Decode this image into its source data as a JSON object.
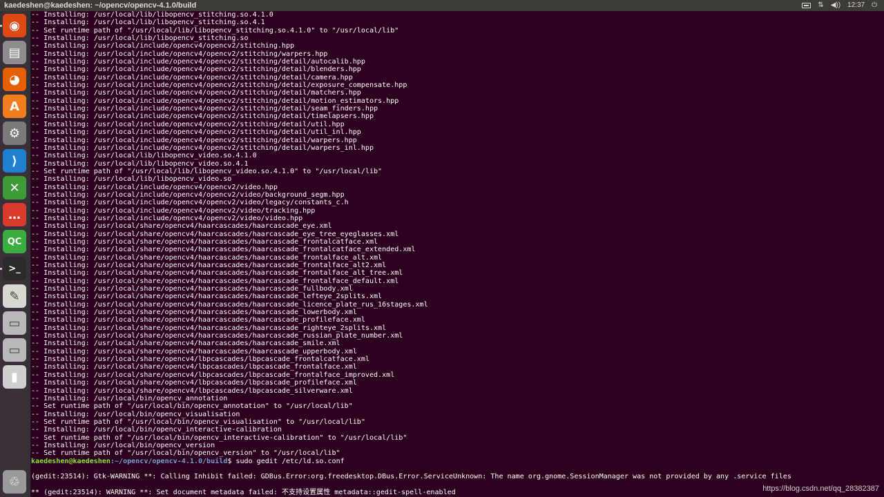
{
  "top_panel": {
    "title": "kaedeshen@kaedeshen: ~/opencv/opencv-4.1.0/build",
    "clock": "12:37",
    "tray_icons": [
      "keyboard-icon",
      "network-icon",
      "volume-icon",
      "power-icon"
    ]
  },
  "launcher": {
    "items": [
      {
        "name": "ubuntu-dash-icon",
        "glyph": "◉",
        "color": "#dd4814"
      },
      {
        "name": "files-icon",
        "glyph": "▤",
        "color": "#8d8d8d"
      },
      {
        "name": "firefox-icon",
        "glyph": "◕",
        "color": "#e66000"
      },
      {
        "name": "software-center-icon",
        "glyph": "A",
        "color": "#f07d1e"
      },
      {
        "name": "system-settings-icon",
        "glyph": "⚙",
        "color": "#7a7a7a"
      },
      {
        "name": "vscode-icon",
        "glyph": "⟩",
        "color": "#1f7fd1"
      },
      {
        "name": "system-tools-icon",
        "glyph": "✕",
        "color": "#3e9b3a"
      },
      {
        "name": "messaging-icon",
        "glyph": "…",
        "color": "#d93a2b"
      },
      {
        "name": "qtcreator-icon",
        "glyph": "QC",
        "color": "#3bac40"
      },
      {
        "name": "terminal-icon",
        "glyph": ">_",
        "color": "#2b2b2b"
      },
      {
        "name": "text-editor-icon",
        "glyph": "✎",
        "color": "#d8d8d0"
      },
      {
        "name": "drive-icon",
        "glyph": "▭",
        "color": "#b9b9b9"
      },
      {
        "name": "drive-2-icon",
        "glyph": "▭",
        "color": "#b9b9b9"
      },
      {
        "name": "usb-drive-icon",
        "glyph": "▮",
        "color": "#cfcfcf"
      },
      {
        "name": "trash-icon",
        "glyph": "♲",
        "color": "#9a9a9a"
      }
    ]
  },
  "terminal": {
    "lines": [
      "-- Installing: /usr/local/lib/libopencv_stitching.so.4.1.0",
      "-- Installing: /usr/local/lib/libopencv_stitching.so.4.1",
      "-- Set runtime path of \"/usr/local/lib/libopencv_stitching.so.4.1.0\" to \"/usr/local/lib\"",
      "-- Installing: /usr/local/lib/libopencv_stitching.so",
      "-- Installing: /usr/local/include/opencv4/opencv2/stitching.hpp",
      "-- Installing: /usr/local/include/opencv4/opencv2/stitching/warpers.hpp",
      "-- Installing: /usr/local/include/opencv4/opencv2/stitching/detail/autocalib.hpp",
      "-- Installing: /usr/local/include/opencv4/opencv2/stitching/detail/blenders.hpp",
      "-- Installing: /usr/local/include/opencv4/opencv2/stitching/detail/camera.hpp",
      "-- Installing: /usr/local/include/opencv4/opencv2/stitching/detail/exposure_compensate.hpp",
      "-- Installing: /usr/local/include/opencv4/opencv2/stitching/detail/matchers.hpp",
      "-- Installing: /usr/local/include/opencv4/opencv2/stitching/detail/motion_estimators.hpp",
      "-- Installing: /usr/local/include/opencv4/opencv2/stitching/detail/seam_finders.hpp",
      "-- Installing: /usr/local/include/opencv4/opencv2/stitching/detail/timelapsers.hpp",
      "-- Installing: /usr/local/include/opencv4/opencv2/stitching/detail/util.hpp",
      "-- Installing: /usr/local/include/opencv4/opencv2/stitching/detail/util_inl.hpp",
      "-- Installing: /usr/local/include/opencv4/opencv2/stitching/detail/warpers.hpp",
      "-- Installing: /usr/local/include/opencv4/opencv2/stitching/detail/warpers_inl.hpp",
      "-- Installing: /usr/local/lib/libopencv_video.so.4.1.0",
      "-- Installing: /usr/local/lib/libopencv_video.so.4.1",
      "-- Set runtime path of \"/usr/local/lib/libopencv_video.so.4.1.0\" to \"/usr/local/lib\"",
      "-- Installing: /usr/local/lib/libopencv_video.so",
      "-- Installing: /usr/local/include/opencv4/opencv2/video.hpp",
      "-- Installing: /usr/local/include/opencv4/opencv2/video/background_segm.hpp",
      "-- Installing: /usr/local/include/opencv4/opencv2/video/legacy/constants_c.h",
      "-- Installing: /usr/local/include/opencv4/opencv2/video/tracking.hpp",
      "-- Installing: /usr/local/include/opencv4/opencv2/video/video.hpp",
      "-- Installing: /usr/local/share/opencv4/haarcascades/haarcascade_eye.xml",
      "-- Installing: /usr/local/share/opencv4/haarcascades/haarcascade_eye_tree_eyeglasses.xml",
      "-- Installing: /usr/local/share/opencv4/haarcascades/haarcascade_frontalcatface.xml",
      "-- Installing: /usr/local/share/opencv4/haarcascades/haarcascade_frontalcatface_extended.xml",
      "-- Installing: /usr/local/share/opencv4/haarcascades/haarcascade_frontalface_alt.xml",
      "-- Installing: /usr/local/share/opencv4/haarcascades/haarcascade_frontalface_alt2.xml",
      "-- Installing: /usr/local/share/opencv4/haarcascades/haarcascade_frontalface_alt_tree.xml",
      "-- Installing: /usr/local/share/opencv4/haarcascades/haarcascade_frontalface_default.xml",
      "-- Installing: /usr/local/share/opencv4/haarcascades/haarcascade_fullbody.xml",
      "-- Installing: /usr/local/share/opencv4/haarcascades/haarcascade_lefteye_2splits.xml",
      "-- Installing: /usr/local/share/opencv4/haarcascades/haarcascade_licence_plate_rus_16stages.xml",
      "-- Installing: /usr/local/share/opencv4/haarcascades/haarcascade_lowerbody.xml",
      "-- Installing: /usr/local/share/opencv4/haarcascades/haarcascade_profileface.xml",
      "-- Installing: /usr/local/share/opencv4/haarcascades/haarcascade_righteye_2splits.xml",
      "-- Installing: /usr/local/share/opencv4/haarcascades/haarcascade_russian_plate_number.xml",
      "-- Installing: /usr/local/share/opencv4/haarcascades/haarcascade_smile.xml",
      "-- Installing: /usr/local/share/opencv4/haarcascades/haarcascade_upperbody.xml",
      "-- Installing: /usr/local/share/opencv4/lbpcascades/lbpcascade_frontalcatface.xml",
      "-- Installing: /usr/local/share/opencv4/lbpcascades/lbpcascade_frontalface.xml",
      "-- Installing: /usr/local/share/opencv4/lbpcascades/lbpcascade_frontalface_improved.xml",
      "-- Installing: /usr/local/share/opencv4/lbpcascades/lbpcascade_profileface.xml",
      "-- Installing: /usr/local/share/opencv4/lbpcascades/lbpcascade_silverware.xml",
      "-- Installing: /usr/local/bin/opencv_annotation",
      "-- Set runtime path of \"/usr/local/bin/opencv_annotation\" to \"/usr/local/lib\"",
      "-- Installing: /usr/local/bin/opencv_visualisation",
      "-- Set runtime path of \"/usr/local/bin/opencv_visualisation\" to \"/usr/local/lib\"",
      "-- Installing: /usr/local/bin/opencv_interactive-calibration",
      "-- Set runtime path of \"/usr/local/bin/opencv_interactive-calibration\" to \"/usr/local/lib\"",
      "-- Installing: /usr/local/bin/opencv_version",
      "-- Set runtime path of \"/usr/local/bin/opencv_version\" to \"/usr/local/lib\""
    ],
    "prompt": {
      "user_host": "kaedeshen@kaedeshen",
      "path": ":~/opencv/opencv-4.1.0/build",
      "command": "$ sudo gedit /etc/ld.so.conf"
    },
    "after_prompt": [
      "",
      "(gedit:23514): Gtk-WARNING **: Calling Inhibit failed: GDBus.Error:org.freedesktop.DBus.Error.ServiceUnknown: The name org.gnome.SessionManager was not provided by any .service files",
      "",
      "** (gedit:23514): WARNING **: Set document metadata failed: 不支持设置属性 metadata::gedit-spell-enabled"
    ]
  },
  "watermark": "https://blog.csdn.net/qq_28382387"
}
